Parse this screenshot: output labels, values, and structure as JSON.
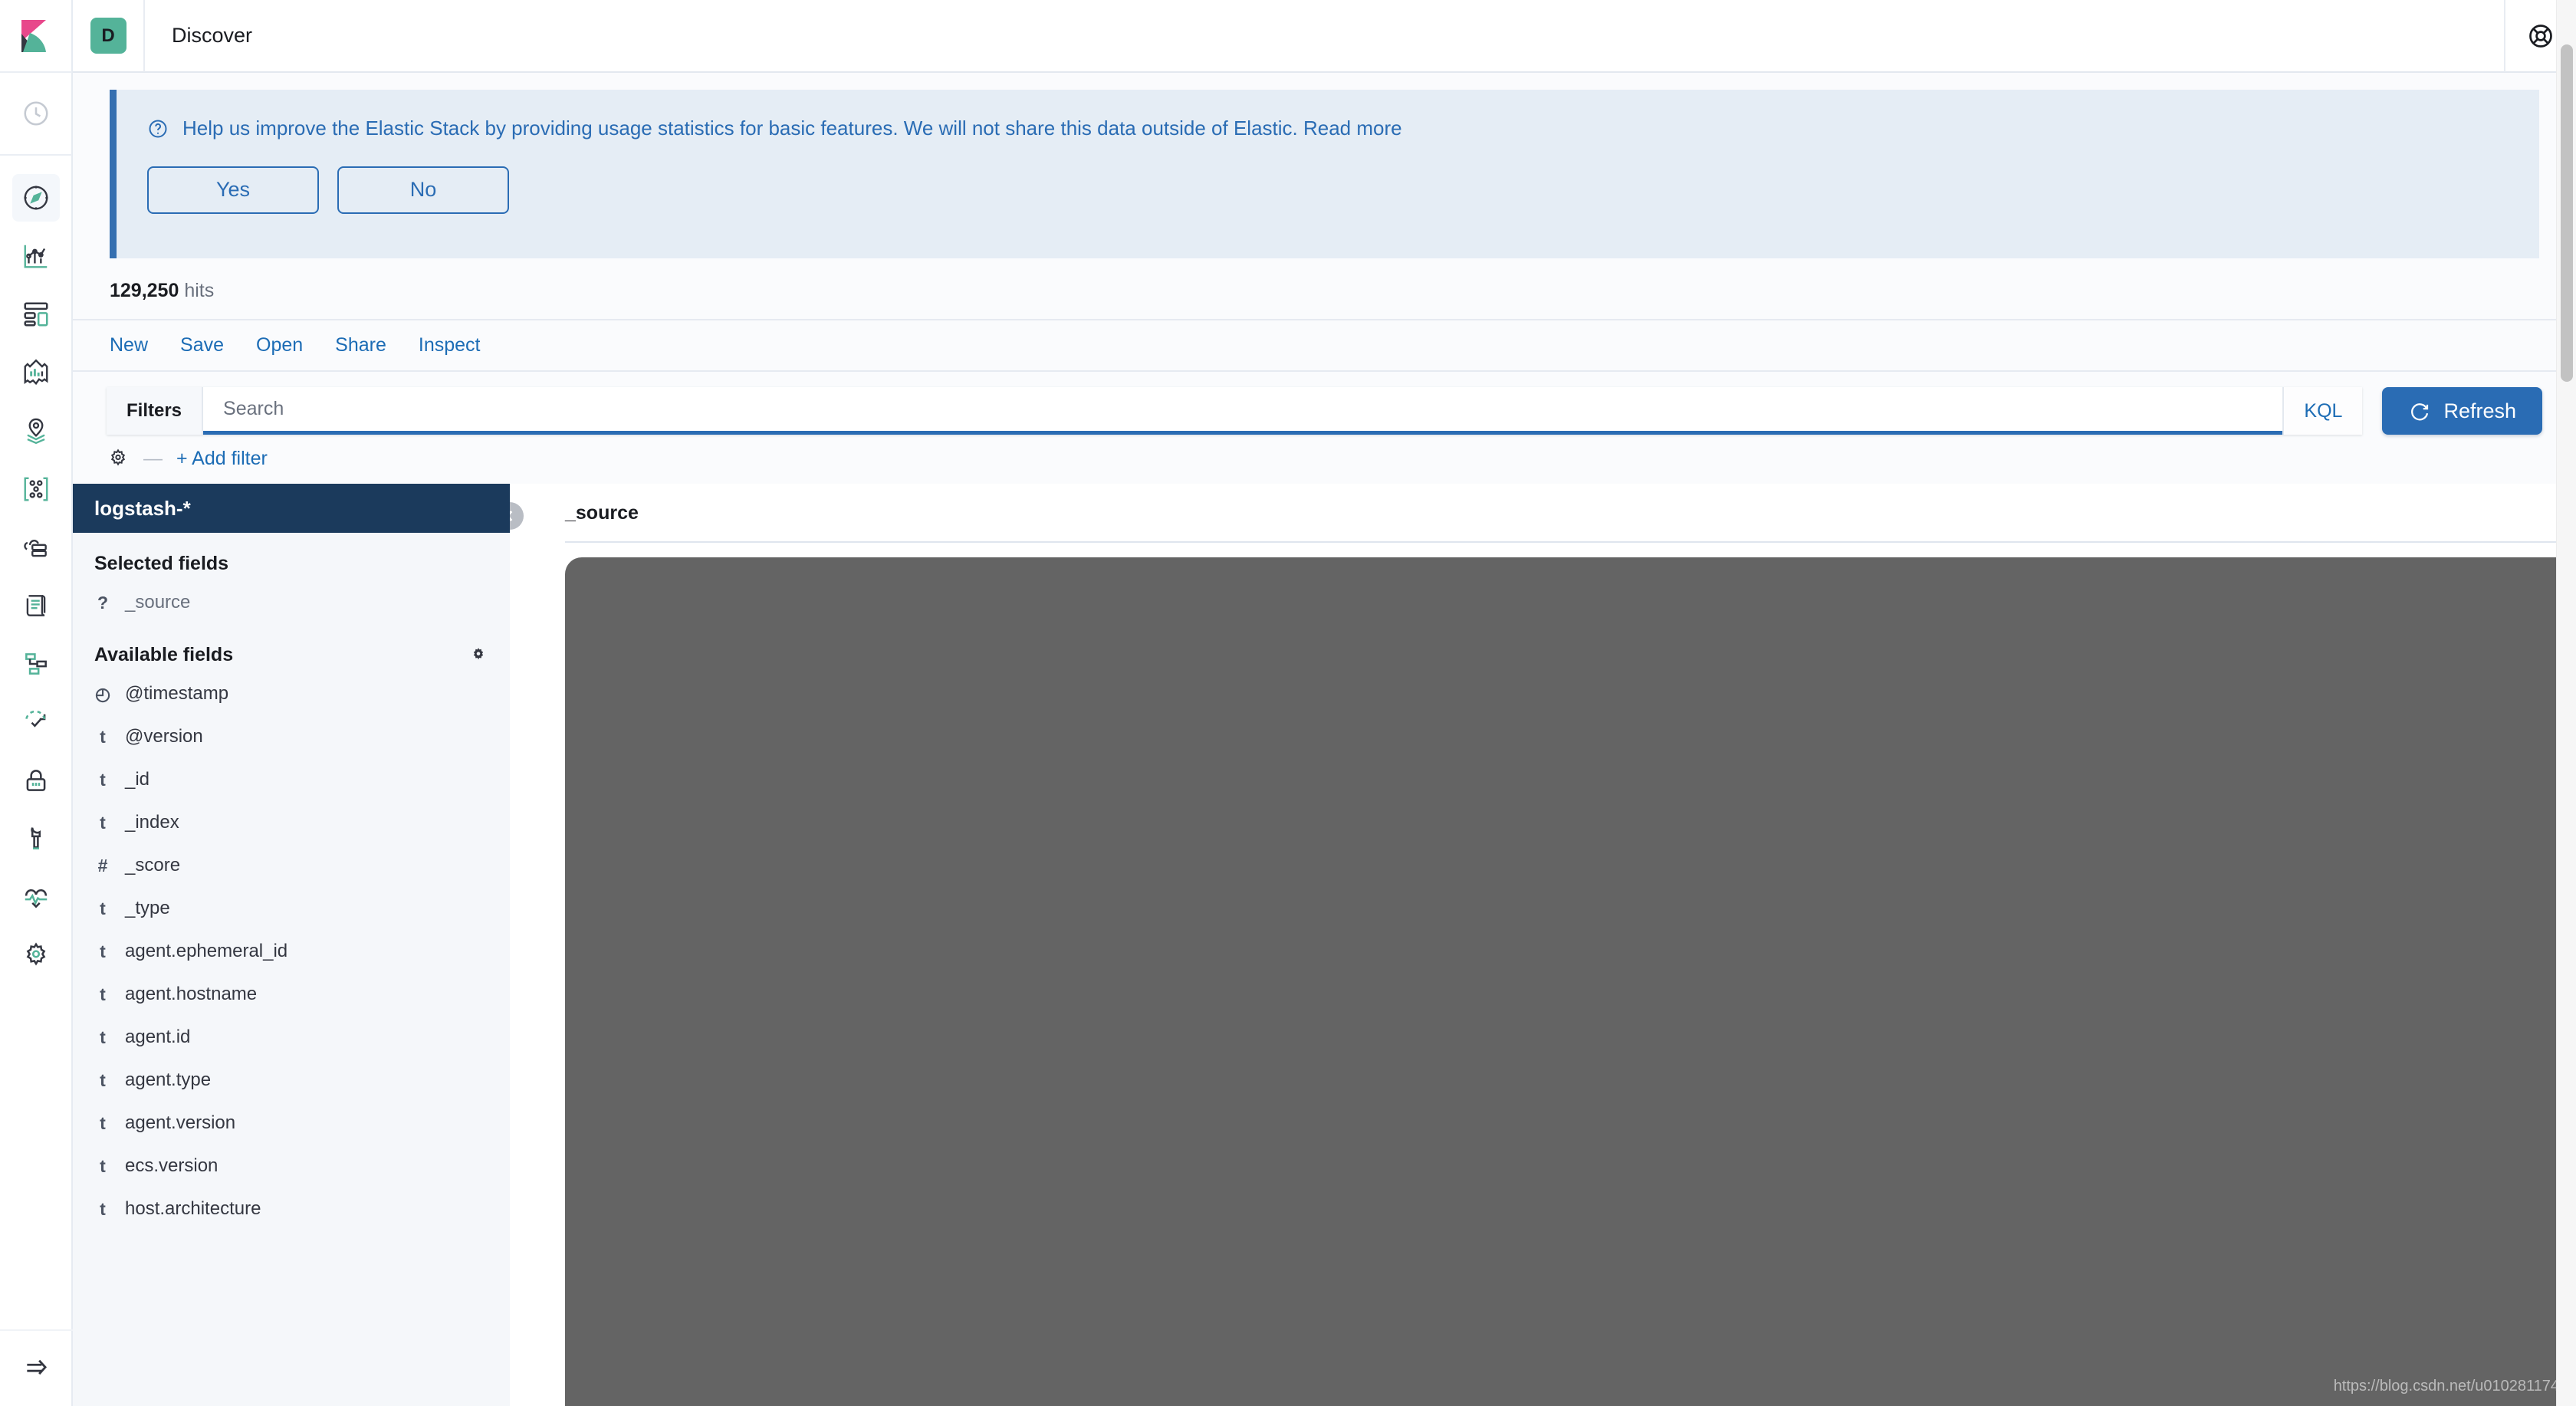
{
  "header": {
    "app_badge": "D",
    "title": "Discover",
    "help_icon": "lifebuoy-icon",
    "logo_icon": "kibana-logo-icon",
    "badge_color": "#54b399"
  },
  "left_nav": {
    "clock_icon": "recently-viewed-clock-icon",
    "collapse_label": "collapse-nav-arrow-icon",
    "items": [
      {
        "name": "discover",
        "icon": "compass-icon",
        "active": true
      },
      {
        "name": "visualize",
        "icon": "line-chart-icon",
        "active": false
      },
      {
        "name": "dashboard",
        "icon": "dashboard-grid-icon",
        "active": false
      },
      {
        "name": "canvas",
        "icon": "canvas-presentation-icon",
        "active": false
      },
      {
        "name": "maps",
        "icon": "map-pin-layers-icon",
        "active": false
      },
      {
        "name": "machine-learning",
        "icon": "ml-nodes-icon",
        "active": false
      },
      {
        "name": "infrastructure",
        "icon": "cloud-server-icon",
        "active": false
      },
      {
        "name": "logs",
        "icon": "document-scroll-icon",
        "active": false
      },
      {
        "name": "apm",
        "icon": "apm-trace-icon",
        "active": false
      },
      {
        "name": "uptime",
        "icon": "uptime-check-icon",
        "active": false
      },
      {
        "name": "siem",
        "icon": "lock-icon",
        "active": false
      },
      {
        "name": "dev-tools",
        "icon": "wrench-icon",
        "active": false
      },
      {
        "name": "monitoring",
        "icon": "heartbeat-icon",
        "active": false
      },
      {
        "name": "management",
        "icon": "gear-icon",
        "active": false
      }
    ]
  },
  "banner": {
    "icon": "question-circle-icon",
    "message": "Help us improve the Elastic Stack by providing usage statistics for basic features. We will not share this data outside of Elastic. Read more",
    "yes_label": "Yes",
    "no_label": "No",
    "accent_color": "#356fb0",
    "background_color": "#e5edf5"
  },
  "hits": {
    "count": "129,250",
    "label": "hits"
  },
  "toolbar": {
    "new_label": "New",
    "save_label": "Save",
    "open_label": "Open",
    "share_label": "Share",
    "inspect_label": "Inspect"
  },
  "query": {
    "filters_label": "Filters",
    "search_value": "",
    "search_placeholder": "Search",
    "language_label": "KQL",
    "refresh_label": "Refresh",
    "refresh_icon": "refresh-circle-icon",
    "refresh_color": "#2a6cb4"
  },
  "filter_row": {
    "options_icon": "gear-icon",
    "separator": "—",
    "add_filter_label": "+ Add filter"
  },
  "sidebar": {
    "index_pattern": "logstash-*",
    "selected_fields_label": "Selected fields",
    "available_fields_label": "Available fields",
    "settings_icon": "gear-icon",
    "selected_fields": [
      {
        "type_icon": "?",
        "name": "_source"
      }
    ],
    "available_fields": [
      {
        "type_icon": "◴",
        "name": "@timestamp"
      },
      {
        "type_icon": "t",
        "name": "@version"
      },
      {
        "type_icon": "t",
        "name": "_id"
      },
      {
        "type_icon": "t",
        "name": "_index"
      },
      {
        "type_icon": "#",
        "name": "_score"
      },
      {
        "type_icon": "t",
        "name": "_type"
      },
      {
        "type_icon": "t",
        "name": "agent.ephemeral_id"
      },
      {
        "type_icon": "t",
        "name": "agent.hostname"
      },
      {
        "type_icon": "t",
        "name": "agent.id"
      },
      {
        "type_icon": "t",
        "name": "agent.type"
      },
      {
        "type_icon": "t",
        "name": "agent.version"
      },
      {
        "type_icon": "t",
        "name": "ecs.version"
      },
      {
        "type_icon": "t",
        "name": "host.architecture"
      }
    ]
  },
  "documents": {
    "collapse_icon": "chevron-left-circle-icon",
    "column_header": "_source"
  },
  "watermark": "https://blog.csdn.net/u010281174"
}
